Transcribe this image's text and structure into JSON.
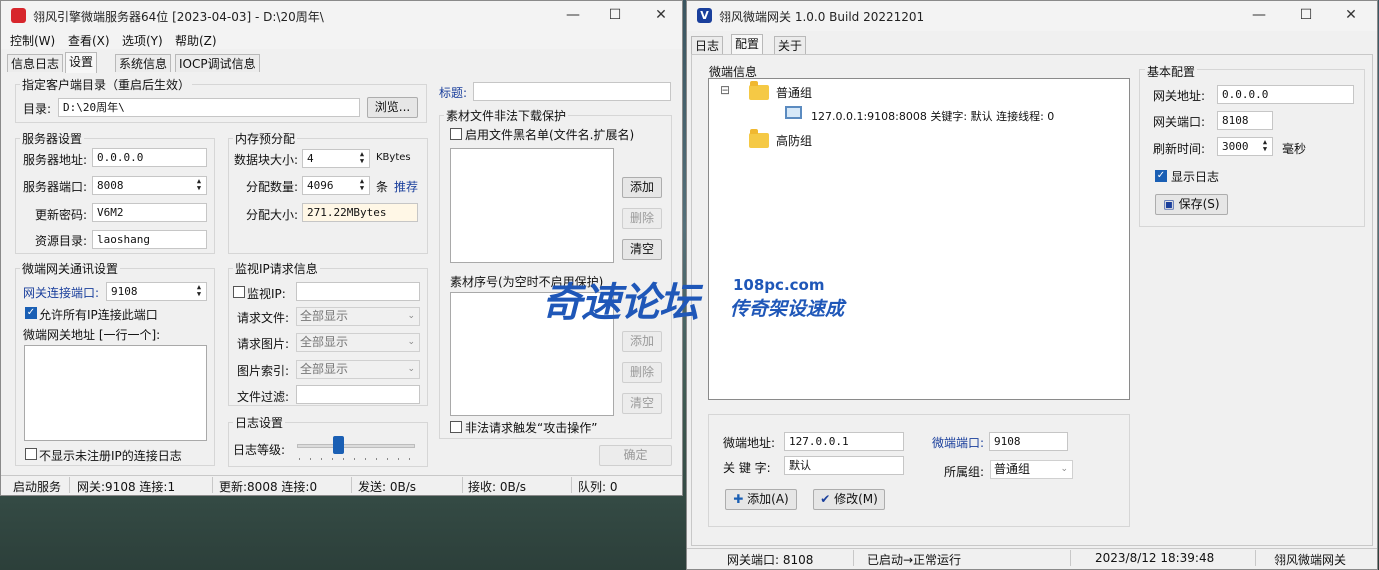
{
  "left_window": {
    "title": "翎风引擎微端服务器64位 [2023-04-03] - D:\\20周年\\",
    "menu": [
      "控制(W)",
      "查看(X)",
      "选项(Y)",
      "帮助(Z)"
    ],
    "tabs": [
      "信息日志",
      "设置",
      "系统信息",
      "IOCP调试信息"
    ],
    "client_dir": {
      "group": "指定客户端目录（重启后生效）",
      "label": "目录:",
      "value": "D:\\20周年\\",
      "browse": "浏览..."
    },
    "server": {
      "group": "服务器设置",
      "addr_label": "服务器地址:",
      "addr": "0.0.0.0",
      "port_label": "服务器端口:",
      "port": "8008",
      "pwd_label": "更新密码:",
      "pwd": "V6M2",
      "res_label": "资源目录:",
      "res": "laoshang"
    },
    "memory": {
      "group": "内存预分配",
      "block_label": "数据块大小:",
      "block": "4",
      "block_unit": "KBytes",
      "count_label": "分配数量:",
      "count": "4096",
      "count_unit": "条",
      "recommend": "推荐",
      "size_label": "分配大小:",
      "size": "271.22MBytes"
    },
    "gateway": {
      "group": "微端网关通讯设置",
      "port_label": "网关连接端口:",
      "port": "9108",
      "allow_all": "允许所有IP连接此端口",
      "addr_label": "微端网关地址 [一行一个]:",
      "hide_log": "不显示未注册IP的连接日志"
    },
    "monitor": {
      "group": "监视IP请求信息",
      "ip_label": "监视IP:",
      "file_label": "请求文件:",
      "file": "全部显示",
      "img_label": "请求图片:",
      "img": "全部显示",
      "idx_label": "图片索引:",
      "idx": "全部显示",
      "filter_label": "文件过滤:"
    },
    "log": {
      "group": "日志设置",
      "level_label": "日志等级:",
      "level": 0.35
    },
    "title_label": "标题:",
    "protect": {
      "group": "素材文件非法下载保护",
      "blacklist": "启用文件黑名单(文件名.扩展名)",
      "add": "添加",
      "del": "删除",
      "clear": "清空",
      "seq_label": "素材序号(为空时不启用保护)",
      "add2": "添加",
      "del2": "删除",
      "clear2": "清空",
      "attack": "非法请求触发“攻击操作”"
    },
    "confirm": "确定",
    "status": [
      "启动服务",
      "网关:9108  连接:1",
      "更新:8008  连接:0",
      "发送: 0B/s",
      "接收: 0B/s",
      "队列: 0"
    ]
  },
  "right_window": {
    "title": "翎风微端网关 1.0.0 Build 20221201",
    "tabs": [
      "日志",
      "配置",
      "关于"
    ],
    "micro_info": "微端信息",
    "tree": {
      "group1": "普通组",
      "server": "127.0.0.1:9108:8008 关键字: 默认 连接线程: 0",
      "group2": "高防组",
      "expander": "⊟"
    },
    "basic": {
      "group": "基本配置",
      "addr_label": "网关地址:",
      "addr": "0.0.0.0",
      "port_label": "网关端口:",
      "port": "8108",
      "refresh_label": "刷新时间:",
      "refresh": "3000",
      "refresh_unit": "毫秒",
      "show_log": "显示日志",
      "save": "保存(S)"
    },
    "form": {
      "addr_label": "微端地址:",
      "addr": "127.0.0.1",
      "port_label": "微端端口:",
      "port": "9108",
      "key_label": "关 键 字:",
      "key": "默认",
      "group_label": "所属组:",
      "group": "普通组",
      "add": "添加(A)",
      "edit": "修改(M)"
    },
    "status": [
      "网关端口: 8108",
      "已启动→正常运行",
      "2023/8/12 18:39:48",
      "翎风微端网关"
    ]
  },
  "watermark": {
    "text": "奇速论坛",
    "url": "108pc.com",
    "slogan": "传奇架设速成"
  },
  "colors": {
    "accent": "#1a5fb4",
    "label_blue": "#1a3f9c",
    "watermark": "#1f57b8"
  }
}
